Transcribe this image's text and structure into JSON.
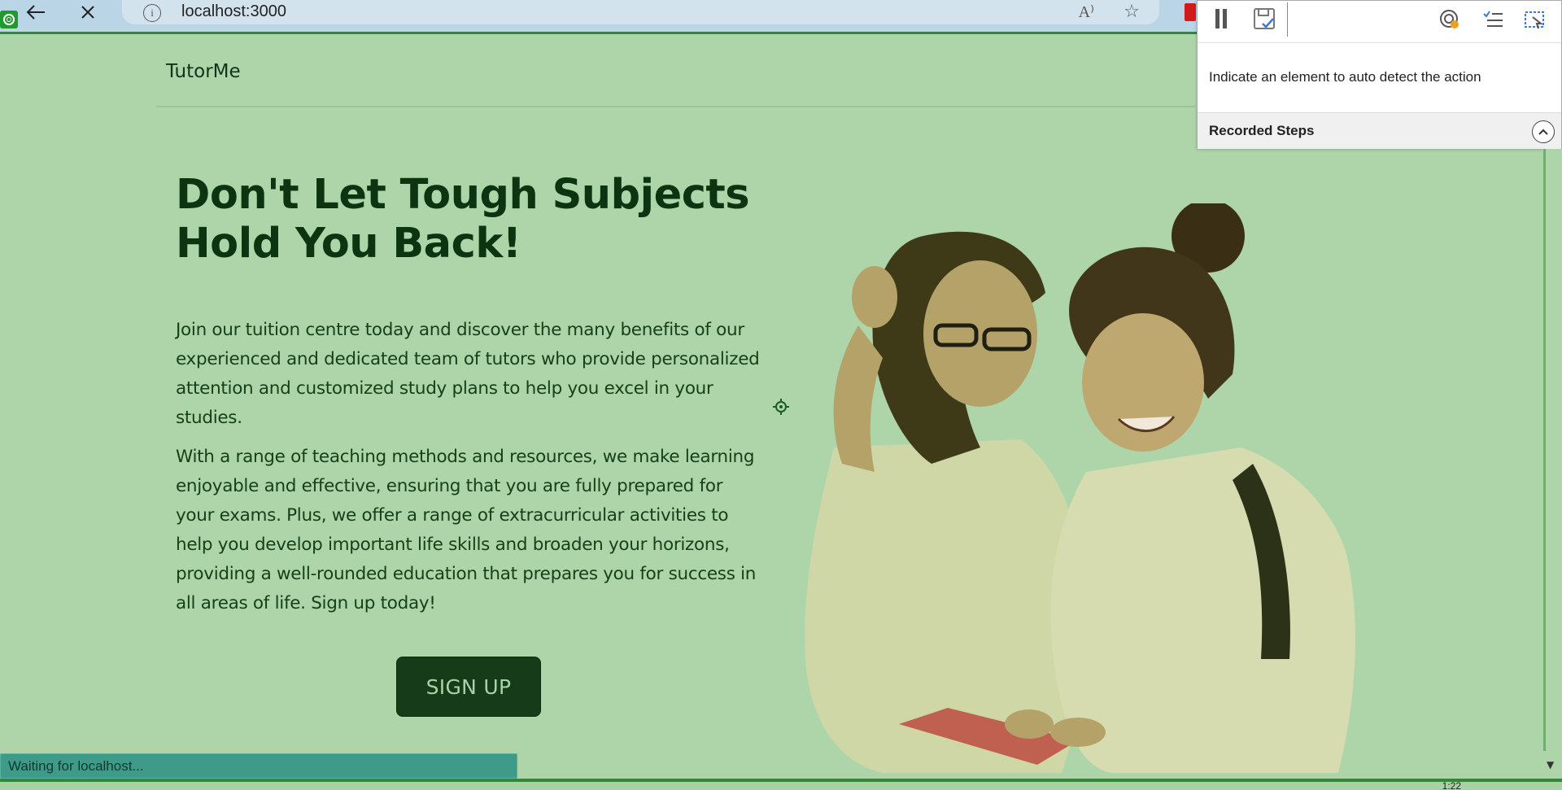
{
  "browser": {
    "url": "localhost:3000",
    "read_aloud_glyph": "A⁾",
    "info_glyph": "i"
  },
  "recorder": {
    "hint": "Indicate an element to auto detect the action",
    "steps_title": "Recorded Steps"
  },
  "page": {
    "brand": "TutorMe",
    "hero_title_line1": "Don't Let Tough Subjects",
    "hero_title_line2": "Hold You Back!",
    "paragraph1": "Join our tuition centre today and discover the many benefits of our experienced and dedicated team of tutors who provide personalized attention and customized study plans to help you excel in your studies.",
    "paragraph2": "With a range of teaching methods and resources, we make learning enjoyable and effective, ensuring that you are fully prepared for your exams. Plus, we offer a range of extracurricular activities to help you develop important life skills and broaden your horizons, providing a well-rounded education that prepares you for success in all areas of life. Sign up today!",
    "signup_label": "SIGN UP"
  },
  "status": {
    "text": "Waiting for localhost..."
  },
  "taskbar": {
    "time": "1:22"
  },
  "colors": {
    "page_bg": "#aed5aa",
    "accent_dark": "#163b18",
    "browser_bar": "#b9d5e6",
    "status_bar": "#3e9b8a"
  },
  "icons": [
    "recording-badge-icon",
    "back-arrow-icon",
    "close-icon",
    "site-info-icon",
    "read-aloud-icon",
    "favorites-add-icon",
    "pause-icon",
    "save-icon",
    "detect-icon",
    "steps-list-icon",
    "select-element-icon",
    "chevron-up-icon",
    "cursor-target-icon",
    "scroll-down-icon"
  ]
}
